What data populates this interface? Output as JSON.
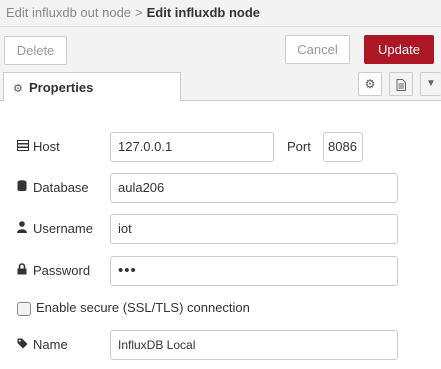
{
  "breadcrumb": {
    "parent": "Edit influxdb out node",
    "separator": ">",
    "current": "Edit influxdb node"
  },
  "toolbar": {
    "delete_label": "Delete",
    "cancel_label": "Cancel",
    "update_label": "Update"
  },
  "tabs": {
    "properties_label": "Properties",
    "icons": [
      "gear-icon",
      "document-icon",
      "caret-down-icon"
    ]
  },
  "form": {
    "host": {
      "label": "Host",
      "value": "127.0.0.1",
      "icon": "server-icon"
    },
    "port": {
      "label": "Port",
      "value": "8086"
    },
    "database": {
      "label": "Database",
      "value": "aula206",
      "icon": "database-icon"
    },
    "username": {
      "label": "Username",
      "value": "iot",
      "icon": "user-icon"
    },
    "password": {
      "label": "Password",
      "value": "•••",
      "icon": "lock-icon"
    },
    "secure": {
      "label": "Enable secure (SSL/TLS) connection",
      "checked": false
    },
    "name": {
      "label": "Name",
      "value": "InfluxDB Local",
      "icon": "tag-icon"
    }
  },
  "colors": {
    "update_button": "#ad1625",
    "toolbar_background": "#f3f3f3"
  }
}
